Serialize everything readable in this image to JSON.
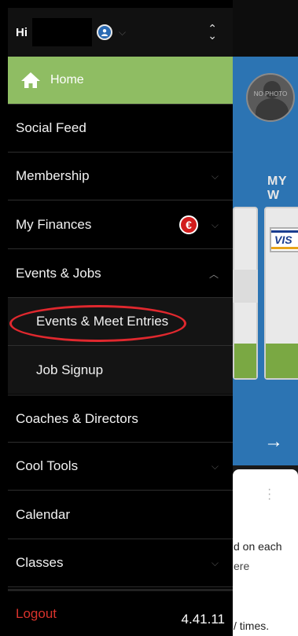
{
  "background": {
    "photo_text": "NO PHOTO",
    "section_label": "MY W",
    "card_brand": "VIS",
    "body_line1": "d on each",
    "body_line2": "ere",
    "body_line3": "/ times."
  },
  "drawer": {
    "greeting": "Hi",
    "menu": {
      "home": "Home",
      "social_feed": "Social Feed",
      "membership": "Membership",
      "my_finances": "My Finances",
      "finances_badge": "€",
      "events_jobs": "Events & Jobs",
      "events_meet_entries": "Events & Meet Entries",
      "job_signup": "Job Signup",
      "coaches_directors": "Coaches & Directors",
      "cool_tools": "Cool Tools",
      "calendar": "Calendar",
      "classes": "Classes"
    },
    "footer": {
      "logout": "Logout",
      "version": "4.41.11"
    }
  },
  "colors": {
    "home_active": "#8fbd63",
    "highlight_oval": "#e0282e",
    "logout": "#d9332c",
    "euro_badge": "#d21c1c",
    "app_accent_blue": "#2c74b3"
  }
}
